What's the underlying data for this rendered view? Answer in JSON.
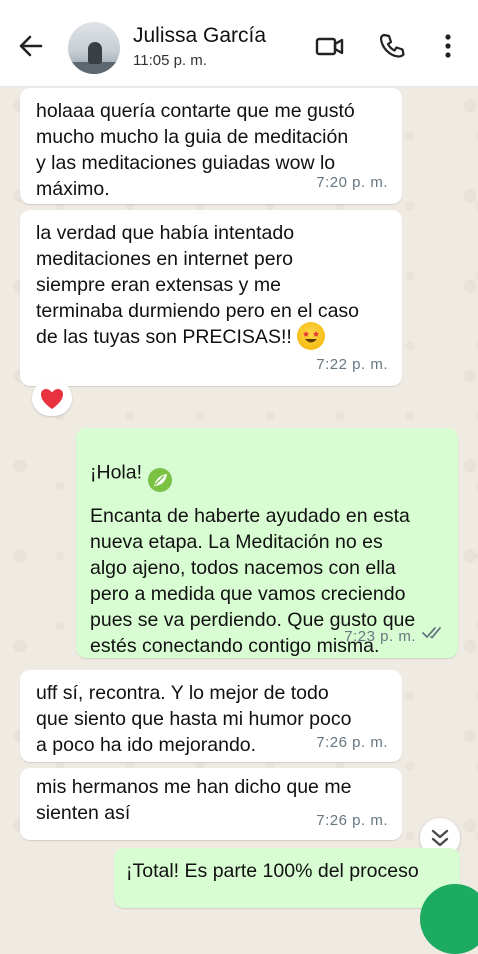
{
  "header": {
    "contact_name": "Julissa García",
    "last_seen": "11:05 p. m.",
    "icons": [
      "back-arrow-icon",
      "video-call-icon",
      "phone-icon",
      "more-vert-icon"
    ]
  },
  "messages": [
    {
      "direction": "in",
      "text": "holaaa quería contarte que me gustó\nmucho mucho la guia de meditación\ny las meditaciones guiadas wow lo\nmáximo.",
      "time": "7:20 p. m."
    },
    {
      "direction": "in",
      "text": "la verdad que había intentado\nmeditaciones en internet pero\nsiempre eran extensas y me\nterminaba durmiendo pero en el caso\nde las tuyas son PRECISAS!!",
      "emoji": "star-struck-emoji",
      "time": "7:22 p. m.",
      "reaction": "red-heart-emoji"
    },
    {
      "direction": "out",
      "greeting": "¡Hola!",
      "greeting_emoji": "leaf-emoji",
      "text": "Encanta de haberte ayudado en esta\nnueva etapa. La Meditación no es\nalgo ajeno, todos nacemos con ella\npero a medida que vamos creciendo\npues se va perdiendo. Que gusto que\nestés conectando contigo misma.",
      "time": "7:23 p. m.",
      "status": "read-double-check-icon"
    },
    {
      "direction": "in",
      "text": "uff sí, recontra. Y lo mejor de todo\nque siento que hasta mi humor poco\na poco ha ido mejorando.",
      "time": "7:26 p. m."
    },
    {
      "direction": "in",
      "text": "mis hermanos me han dicho que me\nsienten así",
      "time": "7:26 p. m."
    },
    {
      "direction": "out",
      "text": "¡Total! Es parte 100% del proceso"
    }
  ],
  "colors": {
    "incoming": "#ffffff",
    "outgoing": "#d9fdd3",
    "timestamp": "#667781",
    "read_tick": "#667781",
    "wallpaper": "#efeae2"
  }
}
